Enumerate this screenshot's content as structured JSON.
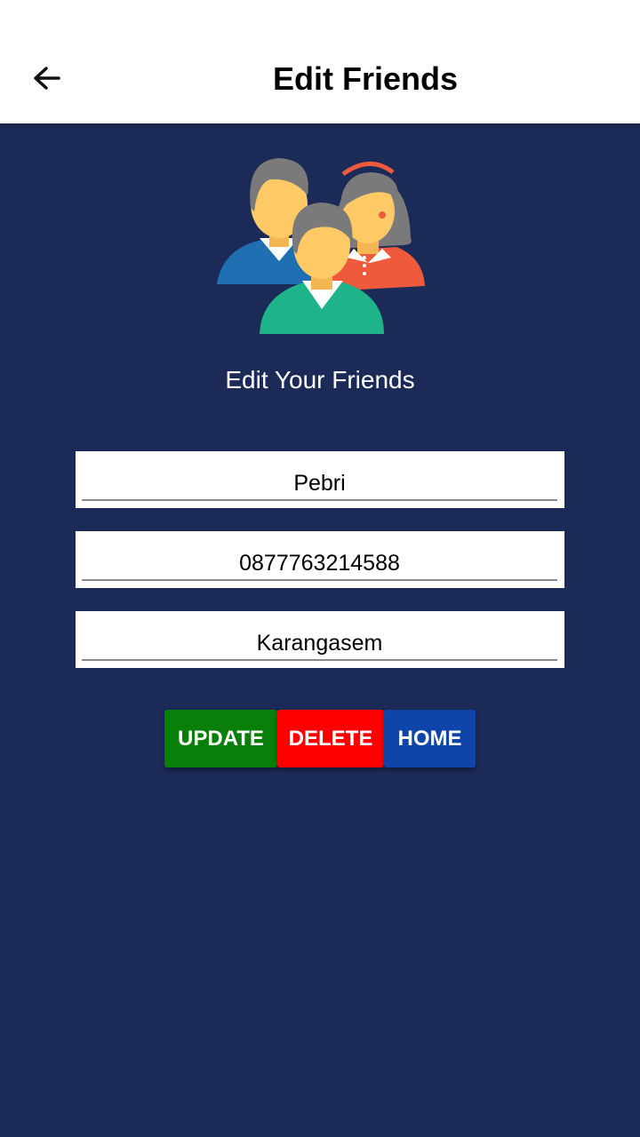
{
  "header": {
    "title": "Edit Friends",
    "back_icon": "arrow-left-icon"
  },
  "hero": {
    "icon": "friends-group-icon",
    "subtitle": "Edit Your Friends"
  },
  "form": {
    "name": {
      "value": "Pebri"
    },
    "phone": {
      "value": "0877763214588"
    },
    "address": {
      "value": "Karangasem"
    }
  },
  "actions": {
    "update_label": "UPDATE",
    "delete_label": "DELETE",
    "home_label": "HOME"
  },
  "colors": {
    "background": "#1b2a57",
    "update": "#087f08",
    "delete": "#ff0000",
    "home": "#0f44a8"
  }
}
